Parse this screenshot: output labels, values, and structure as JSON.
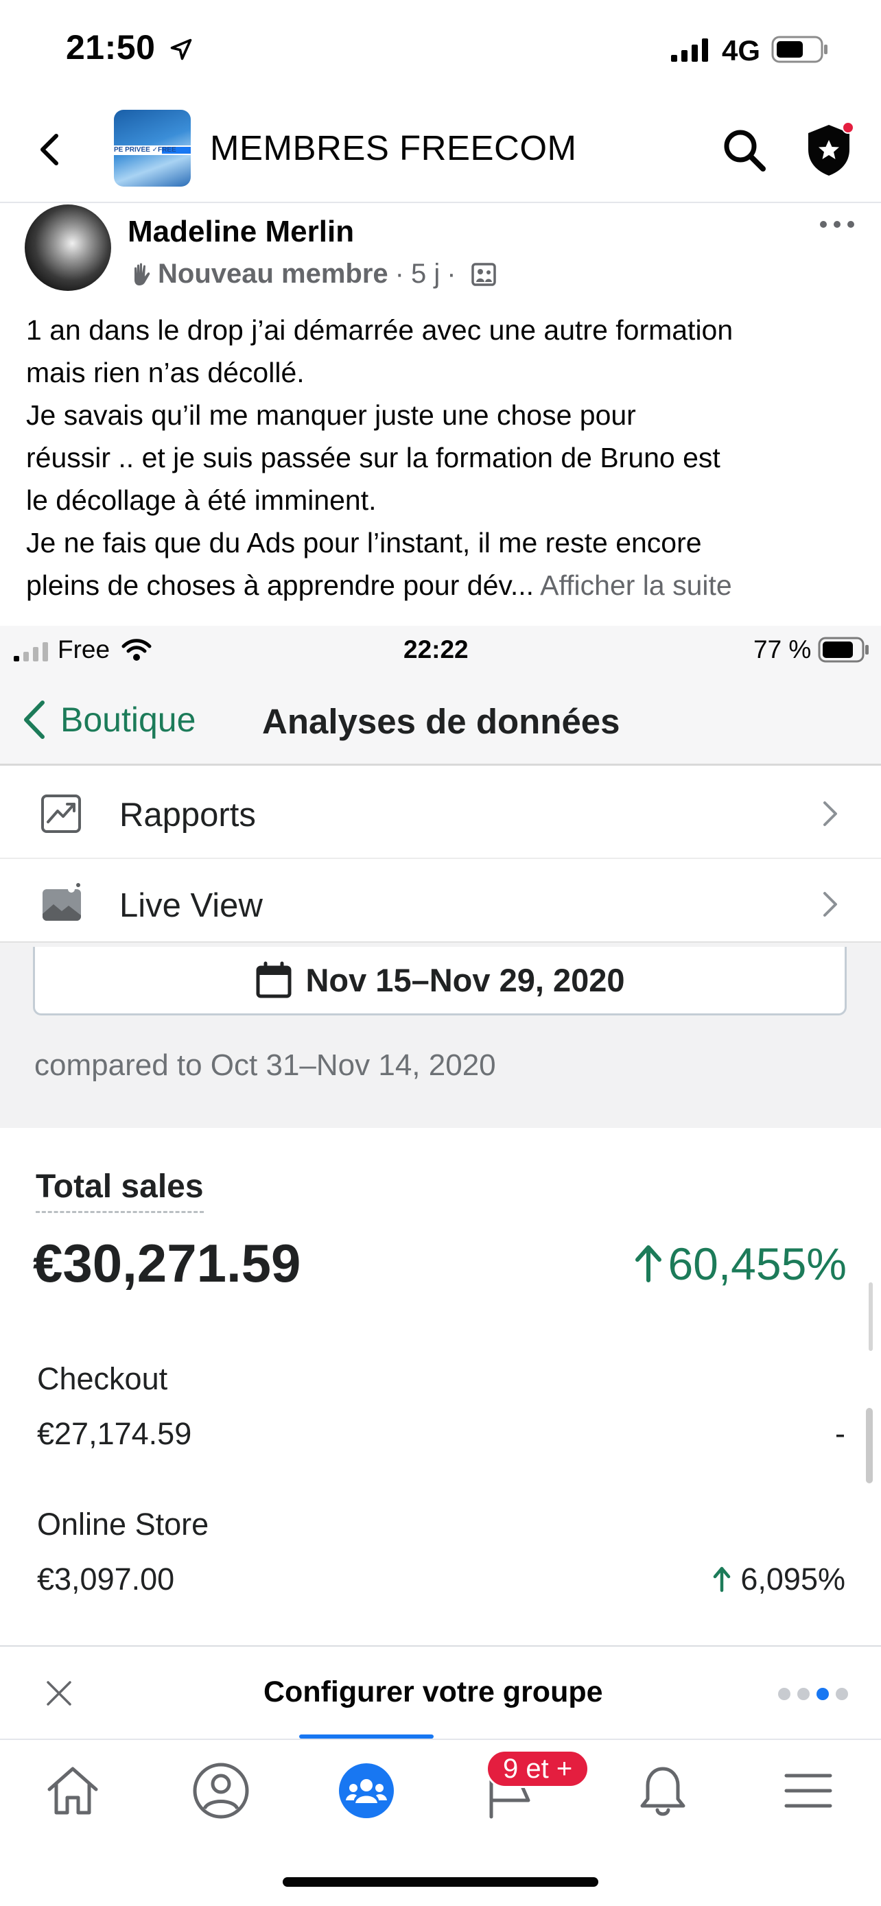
{
  "status_bar": {
    "time": "21:50",
    "network": "4G"
  },
  "group_header": {
    "title": "MEMBRES FREECOM",
    "avatar_text": "PE PRIVÉE ✓FREE"
  },
  "post": {
    "author": "Madeline Merlin",
    "badge": "Nouveau membre",
    "age": "5 j",
    "separator": "·",
    "text_lines": [
      "1 an dans le drop j’ai démarrée avec une autre formation",
      "mais rien n’as décollé.",
      "Je savais qu’il me manquer juste une chose pour",
      "réussir .. et je suis passée sur la formation de Bruno est",
      "le décollage à été imminent.",
      "Je ne fais que du Ads pour l’instant, il me reste encore",
      "pleins de choses à apprendre pour dév..."
    ],
    "see_more": "Afficher la suite"
  },
  "screenshot": {
    "status": {
      "carrier": "Free",
      "time": "22:22",
      "battery": "77 %"
    },
    "nav": {
      "back_label": "Boutique",
      "title": "Analyses de données"
    },
    "menu": [
      {
        "label": "Rapports",
        "icon": "reports-icon"
      },
      {
        "label": "Live View",
        "icon": "live-view-icon"
      }
    ],
    "date_range": "Nov 15–Nov 29, 2020",
    "compare": "compared to Oct 31–Nov 14, 2020",
    "total": {
      "title": "Total sales",
      "value": "€30,271.59",
      "change": "60,455%"
    },
    "channels": [
      {
        "label": "Checkout",
        "value": "€27,174.59",
        "change": "-"
      },
      {
        "label": "Online Store",
        "value": "€3,097.00",
        "change": "6,095%"
      }
    ],
    "colors": {
      "accent_green": "#1c7b59"
    }
  },
  "config_bar": {
    "title": "Configurer votre groupe",
    "page_count": 4,
    "active_page": 3
  },
  "tab_bar": {
    "tabs": [
      "home-icon",
      "profile-icon",
      "groups-icon",
      "pages-icon",
      "notifications-icon",
      "menu-icon"
    ],
    "active": "groups-icon",
    "badge": "9 et +"
  },
  "colors": {
    "facebook_blue": "#1877f2",
    "badge_red": "#e41e3f"
  }
}
